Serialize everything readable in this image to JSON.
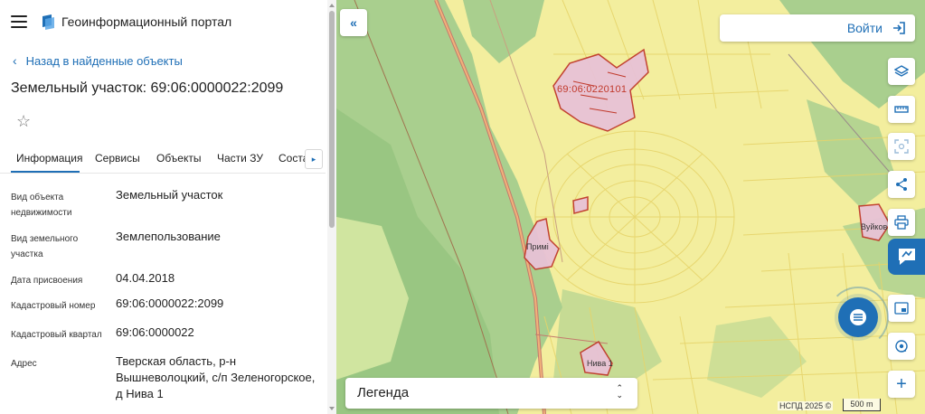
{
  "header": {
    "app_title": "Геоинформационный портал",
    "menu_icon": "hamburger-menu-icon",
    "logo_icon": "portal-logo-icon"
  },
  "panel": {
    "back_link": "Назад в найденные объекты",
    "title": "Земельный участок: 69:06:0000022:2099",
    "tabs": [
      {
        "label": "Информация",
        "active": true
      },
      {
        "label": "Сервисы"
      },
      {
        "label": "Объекты"
      },
      {
        "label": "Части ЗУ"
      },
      {
        "label": "Состав"
      }
    ],
    "info": [
      {
        "label": "Вид объекта недвижимости",
        "value": "Земельный участок"
      },
      {
        "label": "Вид земельного участка",
        "value": "Землепользование"
      },
      {
        "label": "Дата присвоения",
        "value": "04.04.2018"
      },
      {
        "label": "Кадастровый номер",
        "value": "69:06:0000022:2099"
      },
      {
        "label": "Кадастровый квартал",
        "value": "69:06:0000022"
      },
      {
        "label": "Адрес",
        "value": "Тверская область, р-н Вышневолоцкий, с/п Зеленогорское, д Нива 1"
      }
    ]
  },
  "map": {
    "login_label": "Войти",
    "legend_label": "Легенда",
    "copyright": "НСПД 2025 ©",
    "scale_label": "500 m",
    "zoom_in_label": "+",
    "labels": {
      "quarter": "69:06:0220101",
      "village_1": "Вуйков",
      "village_2": "Примі",
      "village_3": "Нива 1"
    },
    "colors": {
      "accent": "#1f6fb6",
      "parcel_outline": "#c0392b",
      "parcel_fill": "#e8c2d6",
      "forest": "#a9cf8e",
      "land": "#f3ee9e"
    }
  }
}
